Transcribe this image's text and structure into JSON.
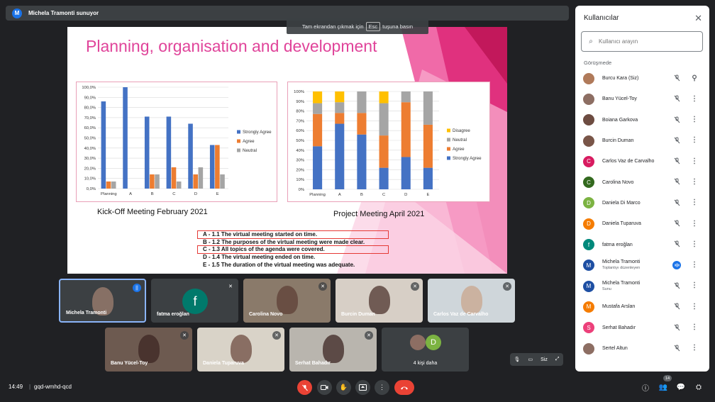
{
  "presenter_bar": {
    "initial": "M",
    "text": "Michela Tramonti sunuyor"
  },
  "esc_tip": {
    "before": "Tam ekrandan çıkmak için",
    "key": "Esc",
    "after": "tuşuna basın"
  },
  "slide": {
    "title": "Planning, organisation and development",
    "caption1": "Kick-Off Meeting February 2021",
    "caption2": "Project Meeting April 2021",
    "questions": [
      "A - 1.1 The virtual meeting started on time.",
      "B - 1.2 The purposes of the virtual meeting were made clear.",
      "C - 1.3 All topics of the agenda were covered.",
      "D - 1.4 The virtual meeting ended on time.",
      "E - 1.5 The duration of the virtual meeting was adequate."
    ]
  },
  "chart_data": [
    {
      "type": "bar",
      "categories": [
        "Planning",
        "A",
        "B",
        "C",
        "D",
        "E"
      ],
      "ylim": [
        0,
        100
      ],
      "yticks": [
        "0,0%",
        "10,0%",
        "20,0%",
        "30,0%",
        "40,0%",
        "50,0%",
        "60,0%",
        "70,0%",
        "80,0%",
        "90,0%",
        "100,0%"
      ],
      "series": [
        {
          "name": "Strongly Agree",
          "color": "#4472c4",
          "values": [
            86,
            100,
            71,
            71,
            64,
            43
          ]
        },
        {
          "name": "Agree",
          "color": "#ed7d31",
          "values": [
            7,
            0,
            14,
            21,
            14,
            43
          ]
        },
        {
          "name": "Neutral",
          "color": "#a5a5a5",
          "values": [
            7,
            0,
            14,
            7,
            21,
            14
          ]
        }
      ],
      "legend": "right",
      "grid": true
    },
    {
      "type": "bar",
      "stacked": true,
      "categories": [
        "Planning",
        "A",
        "B",
        "C",
        "D",
        "E"
      ],
      "ylim": [
        0,
        100
      ],
      "yticks": [
        "0%",
        "10%",
        "20%",
        "30%",
        "40%",
        "50%",
        "60%",
        "70%",
        "80%",
        "90%",
        "100%"
      ],
      "series": [
        {
          "name": "Strongly Agree",
          "color": "#4472c4",
          "values": [
            44,
            67,
            56,
            22,
            33,
            22
          ]
        },
        {
          "name": "Agree",
          "color": "#ed7d31",
          "values": [
            33,
            11,
            22,
            33,
            56,
            44
          ]
        },
        {
          "name": "Neutral",
          "color": "#a5a5a5",
          "values": [
            11,
            11,
            22,
            33,
            11,
            34
          ]
        },
        {
          "name": "Disagree",
          "color": "#ffc000",
          "values": [
            12,
            11,
            0,
            12,
            0,
            0
          ]
        }
      ],
      "legend_order": [
        "Disagree",
        "Neutral",
        "Agree",
        "Strongly Agree"
      ],
      "legend": "right",
      "grid": true
    }
  ],
  "tiles": [
    {
      "name": "Michela Tramonti",
      "badge": "||"
    },
    {
      "name": "fatma eroğlan",
      "initial": "f",
      "badge": "✕"
    },
    {
      "name": "Carolina Novo",
      "badge": "✕"
    },
    {
      "name": "Burcin Duman",
      "badge": "✕"
    },
    {
      "name": "Carlos Vaz de Carvalho",
      "badge": "✕"
    },
    {
      "name": "Banu Yücel-Toy",
      "badge": "✕"
    },
    {
      "name": "Daniela Tuparuva",
      "badge": "✕"
    },
    {
      "name": "Serhat Bahadır",
      "badge": "✕"
    },
    {
      "name": "4 kişi daha",
      "initial": "D"
    }
  ],
  "self_view": {
    "label": "Siz"
  },
  "panel": {
    "title": "Kullanıcılar",
    "search_placeholder": "Kullanıcı arayın",
    "section": "Görüşmede",
    "people": [
      {
        "name": "Burcu Kara (Siz)",
        "sub": "",
        "initial": "",
        "color": "#b07a5a",
        "icon": "pin"
      },
      {
        "name": "Banu Yücel-Toy",
        "sub": "",
        "initial": "",
        "color": "#8d6e63",
        "icon": "more"
      },
      {
        "name": "Boiana Garkova",
        "sub": "",
        "initial": "",
        "color": "#6d4c41",
        "icon": "more"
      },
      {
        "name": "Burcin Duman",
        "sub": "",
        "initial": "",
        "color": "#795548",
        "icon": "more"
      },
      {
        "name": "Carlos Vaz de Carvalho",
        "sub": "",
        "initial": "C",
        "color": "#d81b60",
        "icon": "more"
      },
      {
        "name": "Carolina Novo",
        "sub": "",
        "initial": "C",
        "color": "#33691e",
        "icon": "more"
      },
      {
        "name": "Daniela Di Marco",
        "sub": "",
        "initial": "D",
        "color": "#7cb342",
        "icon": "more"
      },
      {
        "name": "Daniela Tuparuva",
        "sub": "",
        "initial": "D",
        "color": "#f57c00",
        "icon": "more"
      },
      {
        "name": "fatma eroğlan",
        "sub": "",
        "initial": "f",
        "color": "#00897b",
        "icon": "more"
      },
      {
        "name": "Michela Tramonti",
        "sub": "Toplantıyı düzenleyen",
        "initial": "M",
        "color": "#1e4fa3",
        "icon": "more",
        "speaking": true
      },
      {
        "name": "Michela Tramonti",
        "sub": "Sunu",
        "initial": "M",
        "color": "#1e4fa3",
        "icon": "more"
      },
      {
        "name": "Mustafa Arslan",
        "sub": "",
        "initial": "M",
        "color": "#f57c00",
        "icon": "more"
      },
      {
        "name": "Serhat Bahadır",
        "sub": "",
        "initial": "S",
        "color": "#ec407a",
        "icon": "more"
      },
      {
        "name": "Sertel Altun",
        "sub": "",
        "initial": "",
        "color": "#8d6e63",
        "icon": "more"
      }
    ]
  },
  "bottom": {
    "time": "14:49",
    "separator": "|",
    "meeting_code": "gqd-wmhd-qcd",
    "participant_count": "14"
  }
}
